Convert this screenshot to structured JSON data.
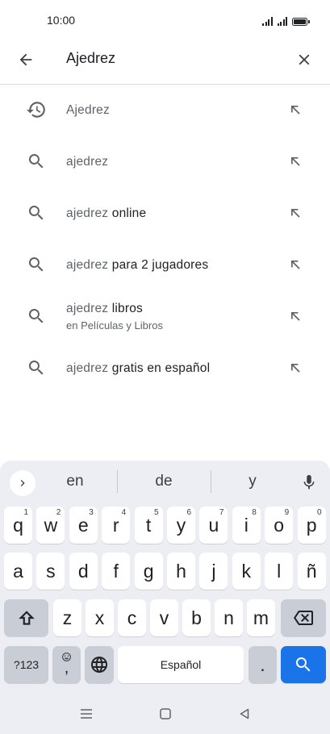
{
  "status_bar": {
    "time": "10:00"
  },
  "search": {
    "query": "Ajedrez"
  },
  "suggestions": [
    {
      "icon": "history-icon",
      "prefix": "Ajedrez",
      "rest": "",
      "sub": ""
    },
    {
      "icon": "search-icon",
      "prefix": "ajedrez",
      "rest": "",
      "sub": ""
    },
    {
      "icon": "search-icon",
      "prefix": "ajedrez",
      "rest": " online",
      "sub": ""
    },
    {
      "icon": "search-icon",
      "prefix": "ajedrez",
      "rest": " para 2 jugadores",
      "sub": ""
    },
    {
      "icon": "search-icon",
      "prefix": "ajedrez",
      "rest": " libros",
      "sub": "en Películas y Libros"
    },
    {
      "icon": "search-icon",
      "prefix": "ajedrez",
      "rest": " gratis en español",
      "sub": ""
    }
  ],
  "keyboard": {
    "predictions": [
      "en",
      "de",
      "y"
    ],
    "row1": [
      {
        "k": "q",
        "h": "1"
      },
      {
        "k": "w",
        "h": "2"
      },
      {
        "k": "e",
        "h": "3"
      },
      {
        "k": "r",
        "h": "4"
      },
      {
        "k": "t",
        "h": "5"
      },
      {
        "k": "y",
        "h": "6"
      },
      {
        "k": "u",
        "h": "7"
      },
      {
        "k": "i",
        "h": "8"
      },
      {
        "k": "o",
        "h": "9"
      },
      {
        "k": "p",
        "h": "0"
      }
    ],
    "row2": [
      "a",
      "s",
      "d",
      "f",
      "g",
      "h",
      "j",
      "k",
      "l",
      "ñ"
    ],
    "row3": [
      "z",
      "x",
      "c",
      "v",
      "b",
      "n",
      "m"
    ],
    "symbols_label": "?123",
    "comma_label": ",",
    "space_label": "Español",
    "period_label": ".",
    "accent_color": "#1a73e8"
  }
}
